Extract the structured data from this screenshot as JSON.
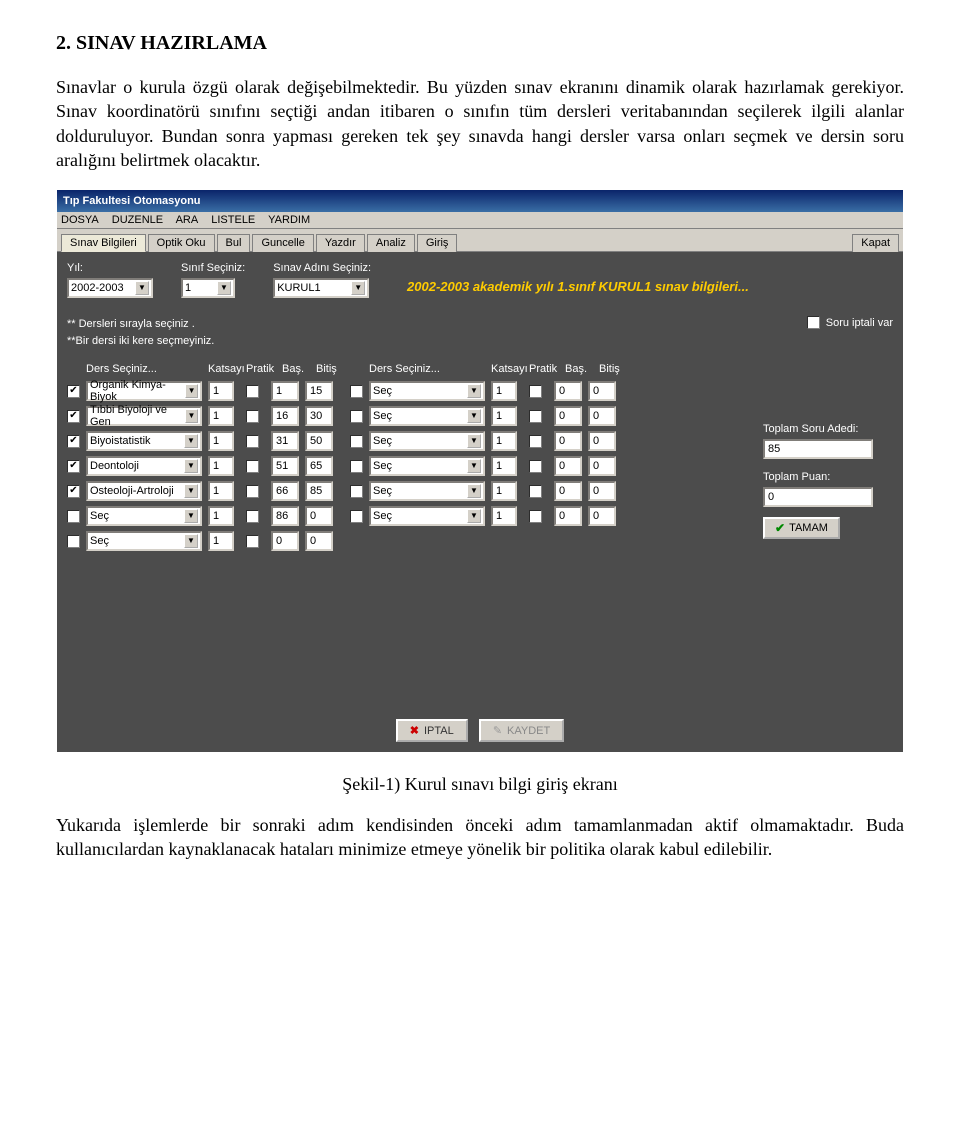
{
  "doc": {
    "heading": "2. SINAV HAZIRLAMA",
    "para1": "Sınavlar o kurula özgü olarak değişebilmektedir. Bu yüzden sınav ekranını dinamik olarak hazırlamak gerekiyor. Sınav koordinatörü sınıfını seçtiği andan itibaren o sınıfın tüm dersleri veritabanından seçilerek ilgili alanlar dolduruluyor. Bundan sonra yapması gereken tek şey sınavda hangi dersler varsa onları seçmek ve dersin soru aralığını belirtmek olacaktır.",
    "caption": "Şekil-1) Kurul sınavı bilgi giriş ekranı",
    "para2": "Yukarıda işlemlerde bir sonraki adım kendisinden önceki adım tamamlanmadan aktif olmamaktadır. Buda kullanıcılardan kaynaklanacak hataları minimize etmeye yönelik bir politika olarak kabul edilebilir."
  },
  "app": {
    "title": "Tıp Fakultesi Otomasyonu",
    "menus": [
      "DOSYA",
      "DUZENLE",
      "ARA",
      "LISTELE",
      "YARDIM"
    ],
    "tabs": [
      "Sınav Bilgileri",
      "Optik Oku",
      "Bul",
      "Guncelle",
      "Yazdır",
      "Analiz",
      "Giriş"
    ],
    "kapat": "Kapat",
    "labels": {
      "yil": "Yıl:",
      "sinif": "Sınıf Seçiniz:",
      "sinav": "Sınav Adını Seçiniz:"
    },
    "selects": {
      "yil": "2002-2003",
      "sinif": "1",
      "sinav": "KURUL1"
    },
    "banner": "2002-2003 akademik yılı 1.sınıf KURUL1 sınav bilgileri...",
    "note1": "** Dersleri sırayla seçiniz .",
    "note2": "**Bir dersi iki kere seçmeyiniz.",
    "soru_iptal": "Soru iptali var",
    "colheaders": {
      "ders": "Ders Seçiniz...",
      "katsayi": "Katsayı",
      "pratik": "Pratik",
      "bas": "Baş.",
      "bitis": "Bitiş"
    },
    "left_rows": [
      {
        "checked": true,
        "ders": "Organik Kimya-Biyok",
        "kat": "1",
        "pratik": false,
        "bas": "1",
        "bit": "15"
      },
      {
        "checked": true,
        "ders": "Tıbbi Biyoloji ve Gen",
        "kat": "1",
        "pratik": false,
        "bas": "16",
        "bit": "30"
      },
      {
        "checked": true,
        "ders": "Biyoistatistik",
        "kat": "1",
        "pratik": false,
        "bas": "31",
        "bit": "50"
      },
      {
        "checked": true,
        "ders": "Deontoloji",
        "kat": "1",
        "pratik": false,
        "bas": "51",
        "bit": "65"
      },
      {
        "checked": true,
        "ders": "Osteoloji-Artroloji",
        "kat": "1",
        "pratik": false,
        "bas": "66",
        "bit": "85"
      },
      {
        "checked": false,
        "ders": "Seç",
        "kat": "1",
        "pratik": false,
        "bas": "86",
        "bit": "0"
      },
      {
        "checked": false,
        "ders": "Seç",
        "kat": "1",
        "pratik": false,
        "bas": "0",
        "bit": "0"
      }
    ],
    "right_rows": [
      {
        "checked": false,
        "ders": "Seç",
        "kat": "1",
        "pratik": false,
        "bas": "0",
        "bit": "0"
      },
      {
        "checked": false,
        "ders": "Seç",
        "kat": "1",
        "pratik": false,
        "bas": "0",
        "bit": "0"
      },
      {
        "checked": false,
        "ders": "Seç",
        "kat": "1",
        "pratik": false,
        "bas": "0",
        "bit": "0"
      },
      {
        "checked": false,
        "ders": "Seç",
        "kat": "1",
        "pratik": false,
        "bas": "0",
        "bit": "0"
      },
      {
        "checked": false,
        "ders": "Seç",
        "kat": "1",
        "pratik": false,
        "bas": "0",
        "bit": "0"
      },
      {
        "checked": false,
        "ders": "Seç",
        "kat": "1",
        "pratik": false,
        "bas": "0",
        "bit": "0"
      }
    ],
    "side": {
      "toplam_soru_lbl": "Toplam Soru Adedi:",
      "toplam_soru": "85",
      "toplam_puan_lbl": "Toplam Puan:",
      "toplam_puan": "0",
      "tamam": "TAMAM"
    },
    "iptal_btn": "IPTAL",
    "kaydet_btn": "KAYDET"
  }
}
